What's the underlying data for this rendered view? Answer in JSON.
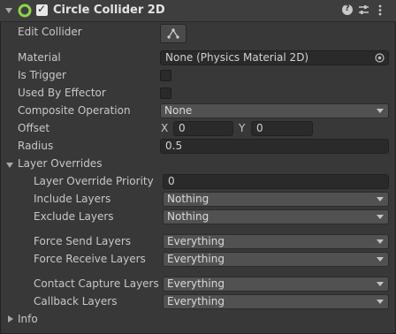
{
  "component": {
    "title": "Circle Collider 2D",
    "enabled_checkbox": "✓"
  },
  "header_icons": [
    "help-icon",
    "presets-icon",
    "more-menu-icon"
  ],
  "props": {
    "edit_collider": "Edit Collider",
    "material_label": "Material",
    "material_value": "None (Physics Material 2D)",
    "is_trigger": "Is Trigger",
    "used_by_effector": "Used By Effector",
    "composite_operation_label": "Composite Operation",
    "composite_operation_value": "None",
    "offset_label": "Offset",
    "offset_x_label": "X",
    "offset_x_value": "0",
    "offset_y_label": "Y",
    "offset_y_value": "0",
    "radius_label": "Radius",
    "radius_value": "0.5"
  },
  "layer_overrides": {
    "title": "Layer Overrides",
    "priority_label": "Layer Override Priority",
    "priority_value": "0",
    "include_label": "Include Layers",
    "include_value": "Nothing",
    "exclude_label": "Exclude Layers",
    "exclude_value": "Nothing",
    "force_send_label": "Force Send Layers",
    "force_send_value": "Everything",
    "force_receive_label": "Force Receive Layers",
    "force_receive_value": "Everything",
    "contact_capture_label": "Contact Capture Layers",
    "contact_capture_value": "Everything",
    "callback_label": "Callback Layers",
    "callback_value": "Everything"
  },
  "info": {
    "title": "Info"
  },
  "colors": {
    "background": "#383838",
    "header": "#3e3e3e",
    "field": "#2a2a2a",
    "dropdown": "#515151",
    "collider_icon": "#8fd14f"
  }
}
